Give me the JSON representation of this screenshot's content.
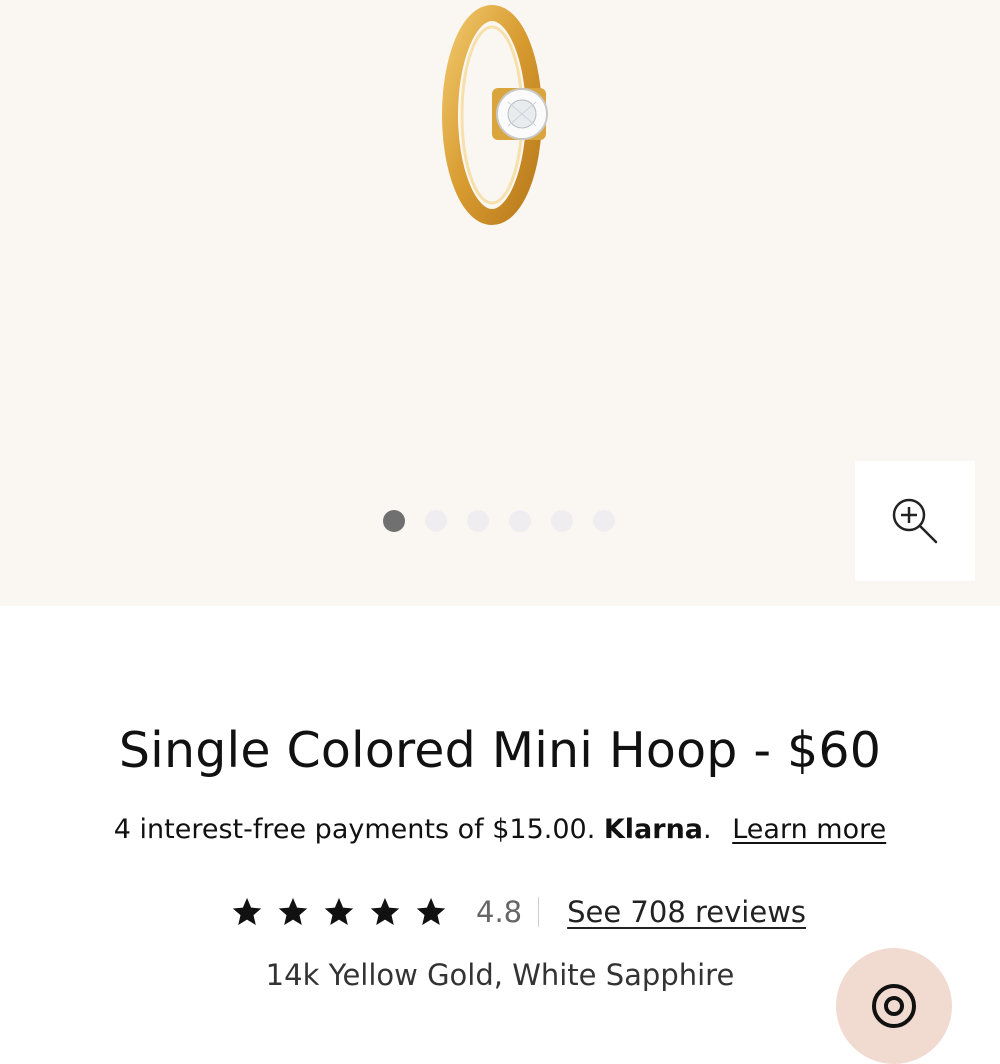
{
  "product": {
    "title": "Single Colored Mini Hoop - $60",
    "payments_text": "4 interest-free payments of $15.00.",
    "payments_brand": "Klarna",
    "payments_brand_suffix": ".",
    "learn_more": "Learn more",
    "rating": "4.8",
    "stars": 5,
    "reviews_link": "See 708 reviews",
    "material": "14k Yellow Gold, White Sapphire"
  },
  "gallery": {
    "image_count": 6,
    "active_index": 0,
    "background_color": "#faf7f3",
    "zoom_icon": "zoom-in-icon"
  },
  "colors": {
    "gold": "#d9a53c",
    "dot_active": "#707070",
    "dot_inactive": "#efedf0",
    "chat_bubble": "#f1dbd1"
  }
}
